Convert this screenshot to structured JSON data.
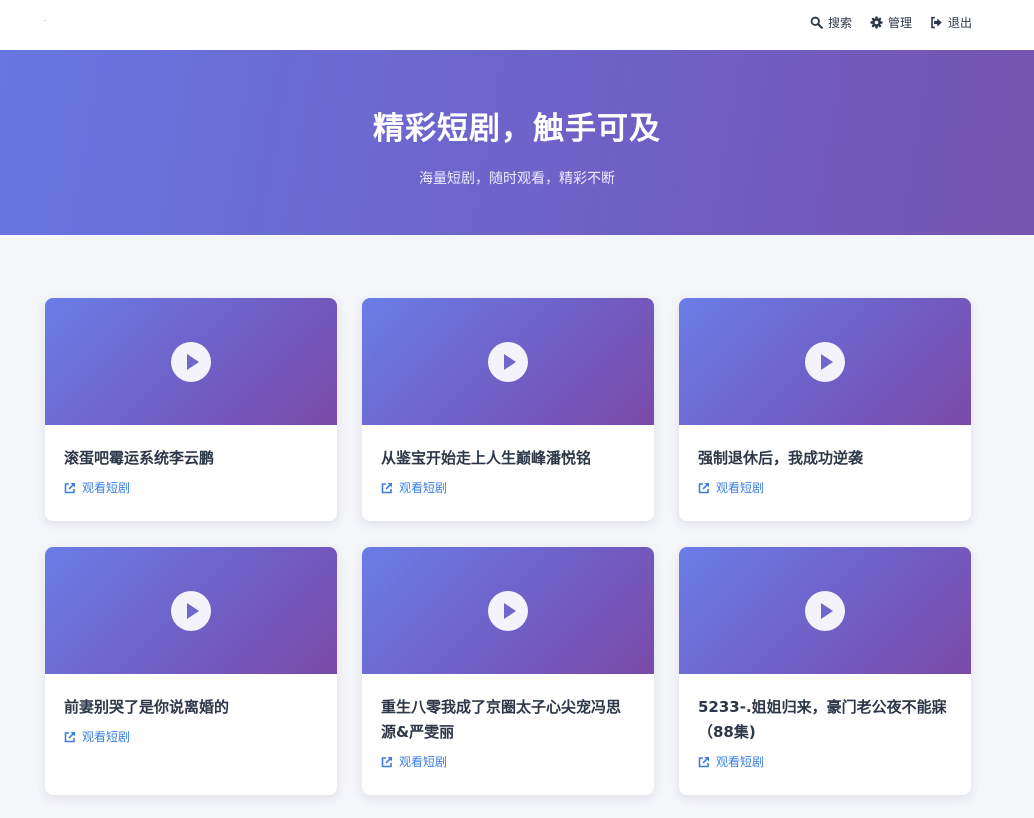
{
  "nav": {
    "search": "搜索",
    "manage": "管理",
    "logout": "退出"
  },
  "hero": {
    "title": "精彩短剧，触手可及",
    "subtitle": "海量短剧，随时观看，精彩不断"
  },
  "watch_label": "观看短剧",
  "cards": [
    {
      "title": "滚蛋吧霉运系统李云鹏"
    },
    {
      "title": "从鉴宝开始走上人生巅峰潘悦铭"
    },
    {
      "title": "强制退休后，我成功逆袭"
    },
    {
      "title": "前妻别哭了是你说离婚的"
    },
    {
      "title": "重生八零我成了京圈太子心尖宠冯思源&严雯丽"
    },
    {
      "title": "5233-.姐姐归来，豪门老公夜不能寐（88集)"
    }
  ],
  "colors": {
    "accent_link": "#3b7fe0",
    "hero_start": "#6776e0",
    "hero_end": "#7454b0"
  }
}
